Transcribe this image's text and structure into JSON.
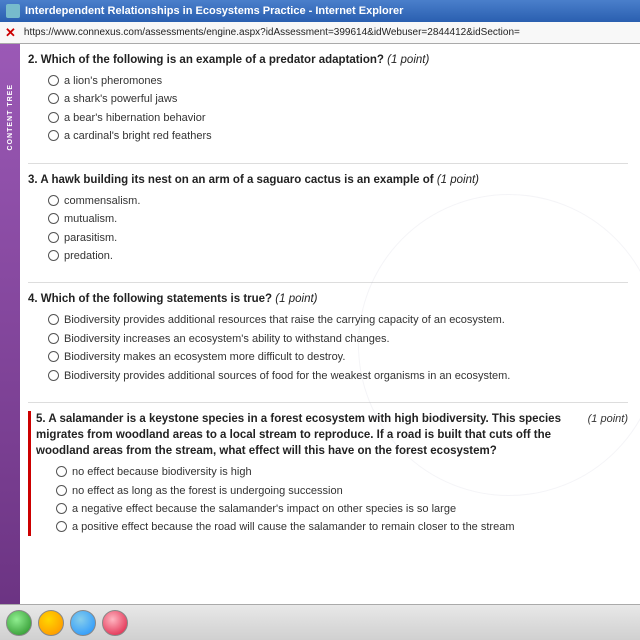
{
  "window": {
    "title": "Interdependent Relationships in Ecosystems Practice - Internet Explorer",
    "url": "https://www.connexus.com/assessments/engine.aspx?idAssessment=399614&idWebuser=2844412&idSection="
  },
  "sidebar": {
    "label": "CONTENT TREE"
  },
  "questions": [
    {
      "id": "q2",
      "number": "2.",
      "text": "Which of the following is an example of a predator adaptation?",
      "points": "(1 point)",
      "options": [
        "a lion's pheromones",
        "a shark's powerful jaws",
        "a bear's hibernation behavior",
        "a cardinal's bright red feathers"
      ]
    },
    {
      "id": "q3",
      "number": "3.",
      "text": "A hawk building its nest on an arm of a saguaro cactus is an example of",
      "points": "(1 point)",
      "options": [
        "commensalism.",
        "mutualism.",
        "parasitism.",
        "predation."
      ]
    },
    {
      "id": "q4",
      "number": "4.",
      "text": "Which of the following statements is true?",
      "points": "(1 point)",
      "options": [
        "Biodiversity provides additional resources that raise the carrying capacity of an ecosystem.",
        "Biodiversity increases an ecosystem's ability to withstand changes.",
        "Biodiversity makes an ecosystem more difficult to destroy.",
        "Biodiversity provides additional sources of food for the weakest organisms in an ecosystem."
      ]
    },
    {
      "id": "q5",
      "number": "5.",
      "text": "A salamander is a keystone species in a forest ecosystem with high biodiversity. This species migrates from woodland areas to a local stream to reproduce. If a road is built that cuts off the woodland areas from the stream, what effect will this have on the forest ecosystem?",
      "points": "(1 point)",
      "options": [
        "no effect because biodiversity is high",
        "no effect as long as the forest is undergoing succession",
        "a negative effect because the salamander's impact on other species is so large",
        "a positive effect because the road will cause the salamander to remain closer to the stream"
      ]
    }
  ],
  "taskbar": {
    "buttons": [
      "green",
      "orange",
      "blue",
      "red"
    ]
  }
}
